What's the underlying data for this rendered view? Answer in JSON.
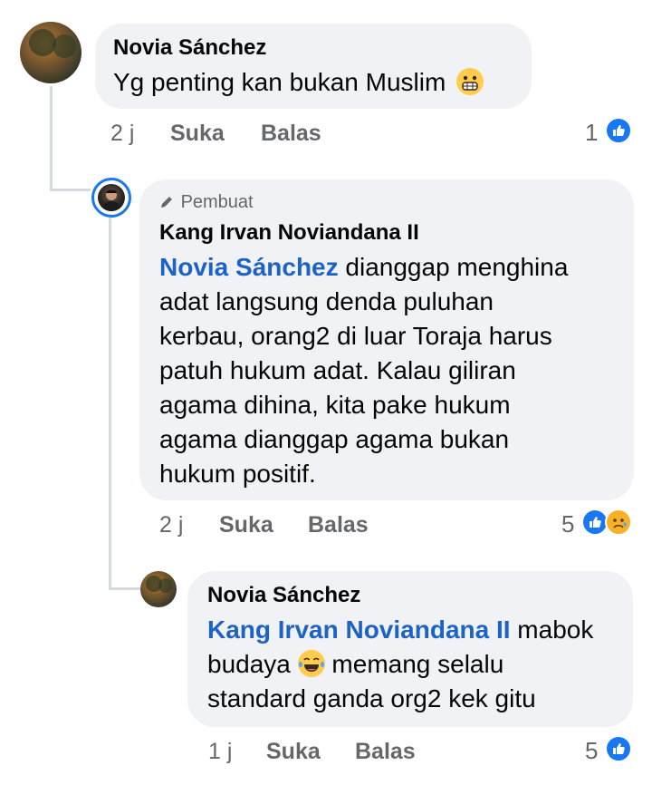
{
  "comments": [
    {
      "author": "Novia Sánchez",
      "text": "Yg penting kan bukan Muslim",
      "emoji": "grimacing-face-emoji",
      "time": "2 j",
      "like_label": "Suka",
      "reply_label": "Balas",
      "reaction_count": "1",
      "reactions": [
        "like"
      ]
    },
    {
      "creator_badge": "Pembuat",
      "author": "Kang Irvan Noviandana II",
      "mention": "Novia Sánchez",
      "lines": [
        " dianggap menghina",
        "adat langsung denda puluhan",
        "kerbau, orang2 di luar Toraja harus",
        "patuh hukum adat. Kalau giliran",
        "agama dihina, kita pake hukum",
        "agama dianggap agama bukan",
        "hukum positif."
      ],
      "time": "2 j",
      "like_label": "Suka",
      "reply_label": "Balas",
      "reaction_count": "5",
      "reactions": [
        "like",
        "sad"
      ]
    },
    {
      "author": "Novia Sánchez",
      "mention": "Kang Irvan Noviandana II",
      "line1_rest": " mabok",
      "line2_a": "budaya ",
      "emoji": "tears-of-joy-emoji",
      "line2_b": " memang selalu",
      "line3": "standard ganda org2 kek gitu",
      "time": "1 j",
      "like_label": "Suka",
      "reply_label": "Balas",
      "reaction_count": "5",
      "reactions": [
        "like"
      ]
    }
  ],
  "colors": {
    "bubble": "#f0f2f5",
    "mention": "#1d63c7",
    "meta": "#65676b",
    "like": "#1877f2",
    "sad": "#f7b125"
  }
}
